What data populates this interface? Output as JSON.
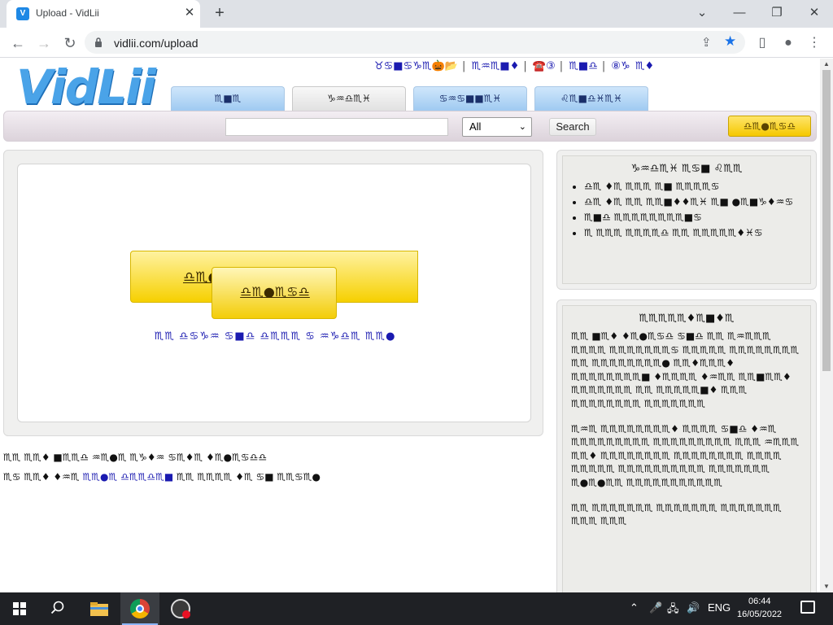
{
  "browser": {
    "tab_title": "Upload - VidLii",
    "tab_favicon": "V",
    "tab_close": "✕",
    "new_tab": "+",
    "minimize": "⌄",
    "min2": "—",
    "restore": "❐",
    "close": "✕",
    "url": "vidlii.com/upload"
  },
  "site": {
    "logo": "VidLii",
    "toplinks": [
      "♉♋■♋♑♏🎃📂",
      "♏♒♏■♦",
      "☎️③",
      "♏■♎",
      "⑧♑",
      "♏♦"
    ],
    "tabs": [
      "♏■♏",
      "♑♒♎♏♓",
      "♋♒♋■■♏♓",
      "♌♏■♎♓♏♓"
    ],
    "search": {
      "placeholder": "",
      "select_value": "All",
      "button": "Search"
    },
    "upload_button": "♎♏●♏♋♎"
  },
  "main": {
    "big_upload_label": "♎♏●♏♎ ♏♏●♏ ♦♏",
    "file_button_label": "♎♏●♏♋♎",
    "hint": "♏♏ ♎♋♑♒ ♋■♎ ♎♏♏♏ ♋ ♒♑♎♏ ♏♏●",
    "below_line1": "♏♏ ♏♏♦ ■♏♏♎ ♒♏●♏ ♏♑♦♒ ♋♏♦♏ ♦♏●♏♋♎♎",
    "below_line2_prefix": "♏♋ ♏♏♦ ♦♒♏ ",
    "below_line2_link": "♏♏●♏ ♎♏♏♎♏■",
    "below_line2_suffix": " ♏♏ ♏♏♏♏ ♦♏ ♋■ ♏♏♋♏●"
  },
  "sidebar": {
    "box1": {
      "title": "♑♒♎♏♓ ♏♋■ ♌♏♏",
      "items": [
        "♎♏ ♦♏ ♏♏♏ ♏■ ♏♏♏♏♋",
        "♎♏ ♦♏ ♏♏ ♏♏■♦♦♏♓ ♏■ ●♏■♑♦♒♋",
        "♏■♎ ♏♏♏♏♏♏♏♏■♋",
        "♏ ♏♏♏ ♏♏♏♏♎ ♏♏ ♏♏♏♏♏♦♓♋"
      ]
    },
    "box2": {
      "title": "♏♏♏♏♏♦♏■♦♏",
      "paragraphs": [
        "♏♏ ■♏♦ ♦♏●♏♋♎ ♋■♎ ♏♏ ♏♒♏♏♏ ♏♏♏♏ ♏♏♏♏♏♏♏♋ ♏♏♏♏♏ ♏♏♏♏♏♏♏♏ ♏♏ ♏♏♏♏♏♏♏♏● ♏♏♦♏♏♏♦ ♏♏♏♏♏♏♏♏■ ♦♏♏♏♏ ♦♒♏♏ ♏♏■♏♏♦ ♏♏♏♏♏♏♏ ♏♏ ♏♏♏♏♏■♦ ♏♏♏ ♏♏♏♏♏♏♏♏ ♏♏♏♏♏♏♏",
        "♏♒♏ ♏♏♏♏♏♏♏♏♦ ♏♏♏♏ ♋■♎ ♦♒♏ ♏♏♏♏♏♏♏♏♏ ♏♏♏♏♏♏♏♏♏ ♏♏♏ ♒♏♏♏ ♏♏♦ ♏♏♏♏♏♏♏♏ ♏♏♏♏♏♏♏♏ ♏♏♏♏ ♏♏♏♏♏ ♏♏♏♏♏♏♏♏♏♏ ♏♏♏♏♏♏♏ ♏●♏●♏♏ ♏♏♏♏♏♏♏♏♏♏♏",
        "♏♏ ♏♏♏♏♏♏♏ ♏♏♏♏♏♏♏ ♏♏♏♏♏♏♏ ♏♏♏ ♏♏♏"
      ]
    }
  },
  "taskbar": {
    "time": "06:44",
    "date": "16/05/2022",
    "lang": "ENG",
    "tray_chevron": "⌃",
    "tray_mic": "🎤",
    "tray_network": "🖧",
    "tray_volume": "🔊"
  }
}
